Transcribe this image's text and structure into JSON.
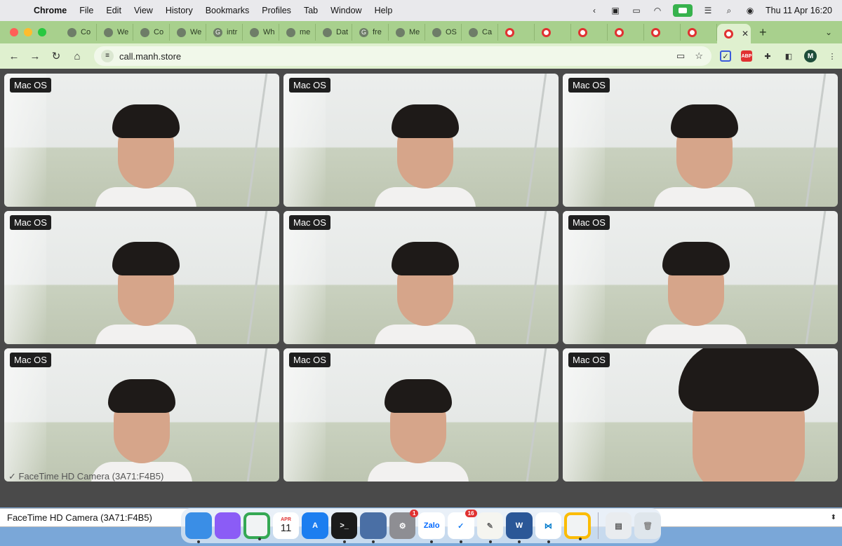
{
  "menubar": {
    "app": "Chrome",
    "items": [
      "File",
      "Edit",
      "View",
      "History",
      "Bookmarks",
      "Profiles",
      "Tab",
      "Window",
      "Help"
    ],
    "clock": "Thu 11 Apr  16:20"
  },
  "tabs": [
    {
      "label": "Co"
    },
    {
      "label": "We"
    },
    {
      "label": "Co"
    },
    {
      "label": "We"
    },
    {
      "label": "intr"
    },
    {
      "label": "Wh"
    },
    {
      "label": "me"
    },
    {
      "label": "Dat"
    },
    {
      "label": "fre"
    },
    {
      "label": "Me"
    },
    {
      "label": "OS"
    },
    {
      "label": "Ca"
    },
    {
      "label": ""
    },
    {
      "label": ""
    },
    {
      "label": ""
    },
    {
      "label": ""
    },
    {
      "label": ""
    },
    {
      "label": ""
    },
    {
      "label": ""
    }
  ],
  "toolbar": {
    "url": "call.manh.store",
    "profile_initial": "M",
    "abp": "ABP"
  },
  "videos": [
    {
      "label": "Mac OS"
    },
    {
      "label": "Mac OS"
    },
    {
      "label": "Mac OS"
    },
    {
      "label": "Mac OS"
    },
    {
      "label": "Mac OS"
    },
    {
      "label": "Mac OS"
    },
    {
      "label": "Mac OS"
    },
    {
      "label": "Mac OS"
    },
    {
      "label": "Mac OS"
    }
  ],
  "camera_overlay": "✓ FaceTime HD Camera (3A71:F4B5)",
  "camera_select": {
    "value": "FaceTime HD Camera (3A71:F4B5)"
  },
  "dock": {
    "calendar_month": "APR",
    "calendar_day": "11",
    "settings_badge": "1",
    "tasks_badge": "16",
    "zalo": "Zalo",
    "word": "W"
  }
}
